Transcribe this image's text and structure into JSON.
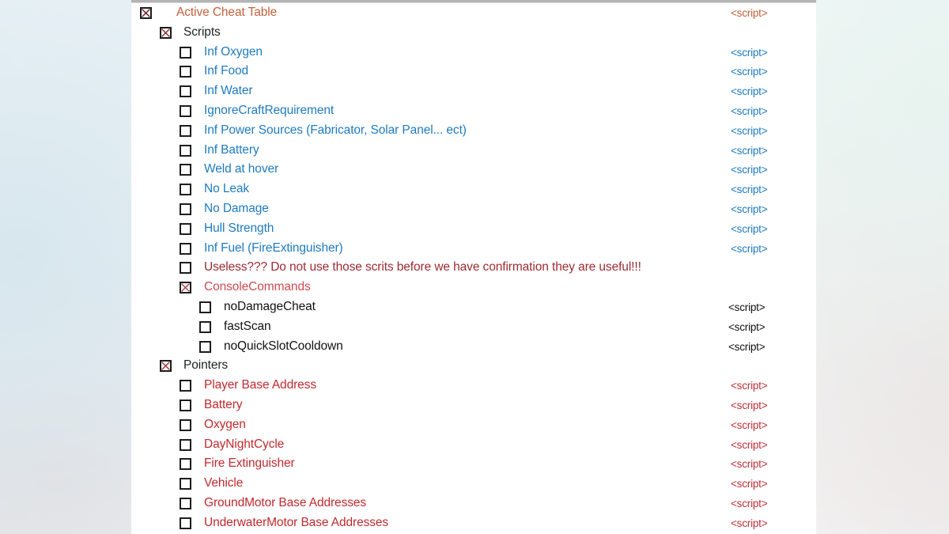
{
  "window": {
    "title": "Active Cheat Table",
    "panel_background": "#ffffff"
  },
  "colors": {
    "table_title": "#c1603c",
    "group_label": "#1b241f",
    "script_blue": "#1f7bbf",
    "script_black": "#111111",
    "script_red": "#bf3038",
    "pointer_red": "#c02a2f",
    "console_red": "#cf4b52",
    "warning_red": "#9e2a33",
    "checkbox_border": "#1d1d1d",
    "check_x_dark": "#5a1c1c",
    "check_x_red": "#a03a3a"
  },
  "script_column": {
    "label": "<script>"
  },
  "tree": [
    {
      "name": "active-cheat-table",
      "level": 0,
      "label": "Active Cheat Table",
      "label_color": "#c1603c",
      "checked": true,
      "check_color": "#6b2222",
      "script": "<script>",
      "script_color": "#c1603c"
    },
    {
      "name": "scripts-group",
      "level": 1,
      "label": "Scripts",
      "label_color": "#1b241f",
      "checked": true,
      "check_color": "#8e2f2f",
      "script": "",
      "script_color": ""
    },
    {
      "name": "inf-oxygen",
      "level": 2,
      "label": "Inf Oxygen",
      "label_color": "#1f7bbf",
      "checked": false,
      "script": "<script>",
      "script_color": "#1f7bbf"
    },
    {
      "name": "inf-food",
      "level": 2,
      "label": "Inf Food",
      "label_color": "#1f7bbf",
      "checked": false,
      "script": "<script>",
      "script_color": "#1f7bbf"
    },
    {
      "name": "inf-water",
      "level": 2,
      "label": "Inf Water",
      "label_color": "#1f7bbf",
      "checked": false,
      "script": "<script>",
      "script_color": "#1f7bbf"
    },
    {
      "name": "ignore-craft-requirement",
      "level": 2,
      "label": "IgnoreCraftRequirement",
      "label_color": "#1f7bbf",
      "checked": false,
      "script": "<script>",
      "script_color": "#1f7bbf"
    },
    {
      "name": "inf-power-sources",
      "level": 2,
      "label": "Inf Power Sources (Fabricator, Solar Panel... ect)",
      "label_color": "#1f7bbf",
      "checked": false,
      "script": "<script>",
      "script_color": "#1f7bbf"
    },
    {
      "name": "inf-battery",
      "level": 2,
      "label": "Inf Battery",
      "label_color": "#1f7bbf",
      "checked": false,
      "script": "<script>",
      "script_color": "#1f7bbf"
    },
    {
      "name": "weld-at-hover",
      "level": 2,
      "label": "Weld at hover",
      "label_color": "#1f7bbf",
      "checked": false,
      "script": "<script>",
      "script_color": "#1f7bbf"
    },
    {
      "name": "no-leak",
      "level": 2,
      "label": "No Leak",
      "label_color": "#1f7bbf",
      "checked": false,
      "script": "<script>",
      "script_color": "#1f7bbf"
    },
    {
      "name": "no-damage",
      "level": 2,
      "label": "No Damage",
      "label_color": "#1f7bbf",
      "checked": false,
      "script": "<script>",
      "script_color": "#1f7bbf"
    },
    {
      "name": "hull-strength",
      "level": 2,
      "label": "Hull Strength",
      "label_color": "#1f7bbf",
      "checked": false,
      "script": "<script>",
      "script_color": "#1f7bbf"
    },
    {
      "name": "inf-fuel-fire-extinguisher",
      "level": 2,
      "label": "Inf Fuel (FireExtinguisher)",
      "label_color": "#1f7bbf",
      "checked": false,
      "script": "<script>",
      "script_color": "#1f7bbf"
    },
    {
      "name": "useless-warning",
      "level": 2,
      "label": "Useless??? Do not use those scrits before we have confirmation they are useful!!!",
      "label_color": "#9e2a33",
      "checked": false,
      "script": "",
      "script_color": ""
    },
    {
      "name": "console-commands-group",
      "level": 2,
      "label": "ConsoleCommands",
      "label_color": "#cf4b52",
      "checked": true,
      "check_color": "#b04a50",
      "script": "",
      "script_color": ""
    },
    {
      "name": "no-damage-cheat",
      "level": 3,
      "label": "noDamageCheat",
      "label_color": "#111111",
      "checked": false,
      "script": "<script>",
      "script_color": "#111111"
    },
    {
      "name": "fast-scan",
      "level": 3,
      "label": "fastScan",
      "label_color": "#111111",
      "checked": false,
      "script": "<script>",
      "script_color": "#111111"
    },
    {
      "name": "no-quick-slot-cooldown",
      "level": 3,
      "label": "noQuickSlotCooldown",
      "label_color": "#111111",
      "checked": false,
      "script": "<script>",
      "script_color": "#111111"
    },
    {
      "name": "pointers-group",
      "level": 1,
      "label": "Pointers",
      "label_color": "#1b241f",
      "checked": true,
      "check_color": "#a03a3a",
      "script": "",
      "script_color": ""
    },
    {
      "name": "player-base-address",
      "level": 2,
      "label": "Player Base Address",
      "label_color": "#c02a2f",
      "checked": false,
      "script": "<script>",
      "script_color": "#bf3038"
    },
    {
      "name": "battery",
      "level": 2,
      "label": "Battery",
      "label_color": "#c02a2f",
      "checked": false,
      "script": "<script>",
      "script_color": "#bf3038"
    },
    {
      "name": "oxygen",
      "level": 2,
      "label": "Oxygen",
      "label_color": "#c02a2f",
      "checked": false,
      "script": "<script>",
      "script_color": "#bf3038"
    },
    {
      "name": "day-night-cycle",
      "level": 2,
      "label": "DayNightCycle",
      "label_color": "#c02a2f",
      "checked": false,
      "script": "<script>",
      "script_color": "#bf3038"
    },
    {
      "name": "fire-extinguisher",
      "level": 2,
      "label": "Fire Extinguisher",
      "label_color": "#c02a2f",
      "checked": false,
      "script": "<script>",
      "script_color": "#bf3038"
    },
    {
      "name": "vehicle",
      "level": 2,
      "label": "Vehicle",
      "label_color": "#c02a2f",
      "checked": false,
      "script": "<script>",
      "script_color": "#bf3038"
    },
    {
      "name": "ground-motor-base-addresses",
      "level": 2,
      "label": "GroundMotor Base Addresses",
      "label_color": "#c02a2f",
      "checked": false,
      "script": "<script>",
      "script_color": "#bf3038"
    },
    {
      "name": "underwater-motor-base-addresses",
      "level": 2,
      "label": "UnderwaterMotor Base Addresses",
      "label_color": "#c02a2f",
      "checked": false,
      "script": "<script>",
      "script_color": "#bf3038"
    }
  ]
}
